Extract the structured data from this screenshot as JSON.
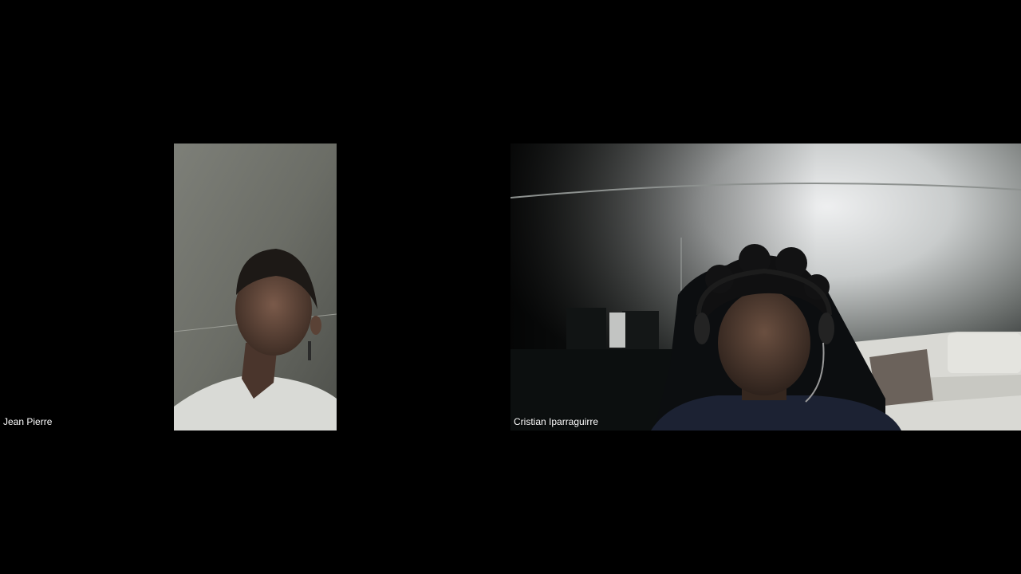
{
  "meeting": {
    "background_color": "#000000",
    "participants": [
      {
        "name": "Jean Pierre",
        "video_state": "camera-on",
        "video_orientation": "portrait"
      },
      {
        "name": "Cristian Iparraguirre",
        "video_state": "camera-on",
        "video_orientation": "landscape"
      }
    ]
  },
  "colors": {
    "label_text": "#ffffff",
    "tile_background": "#000000"
  }
}
